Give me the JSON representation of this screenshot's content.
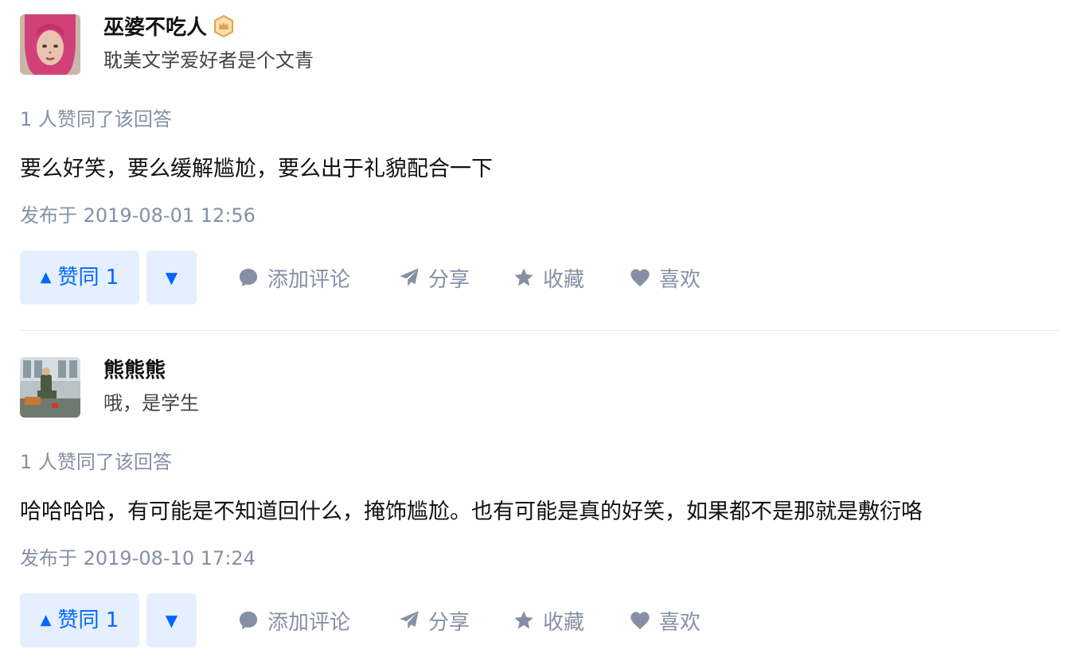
{
  "answers": [
    {
      "author_name": "巫婆不吃人",
      "author_bio": "耽美文学爱好者是个文青",
      "vote_meta": "1 人赞同了该回答",
      "content": "要么好笑，要么缓解尴尬，要么出于礼貌配合一下",
      "published": "发布于 2019-08-01 12:56",
      "upvote_label": "赞同 1",
      "comment_label": "添加评论",
      "share_label": "分享",
      "favorite_label": "收藏",
      "like_label": "喜欢"
    },
    {
      "author_name": "熊熊熊",
      "author_bio": "哦，是学生",
      "vote_meta": "1 人赞同了该回答",
      "content": "哈哈哈哈，有可能是不知道回什么，掩饰尴尬。也有可能是真的好笑，如果都不是那就是敷衍咯",
      "published": "发布于 2019-08-10 17:24",
      "upvote_label": "赞同 1",
      "comment_label": "添加评论",
      "share_label": "分享",
      "favorite_label": "收藏",
      "like_label": "喜欢"
    }
  ],
  "icons": {
    "upvote": "triangle-up-icon",
    "downvote": "triangle-down-icon",
    "comment": "comment-bubble-icon",
    "share": "paper-plane-icon",
    "favorite": "star-icon",
    "like": "heart-icon",
    "badge": "crown-badge-icon"
  },
  "colors": {
    "accent": "#0066ff",
    "accent_bg": "#e5efff",
    "meta": "#8590a6",
    "text": "#121212",
    "badge": "#e6a23c"
  }
}
